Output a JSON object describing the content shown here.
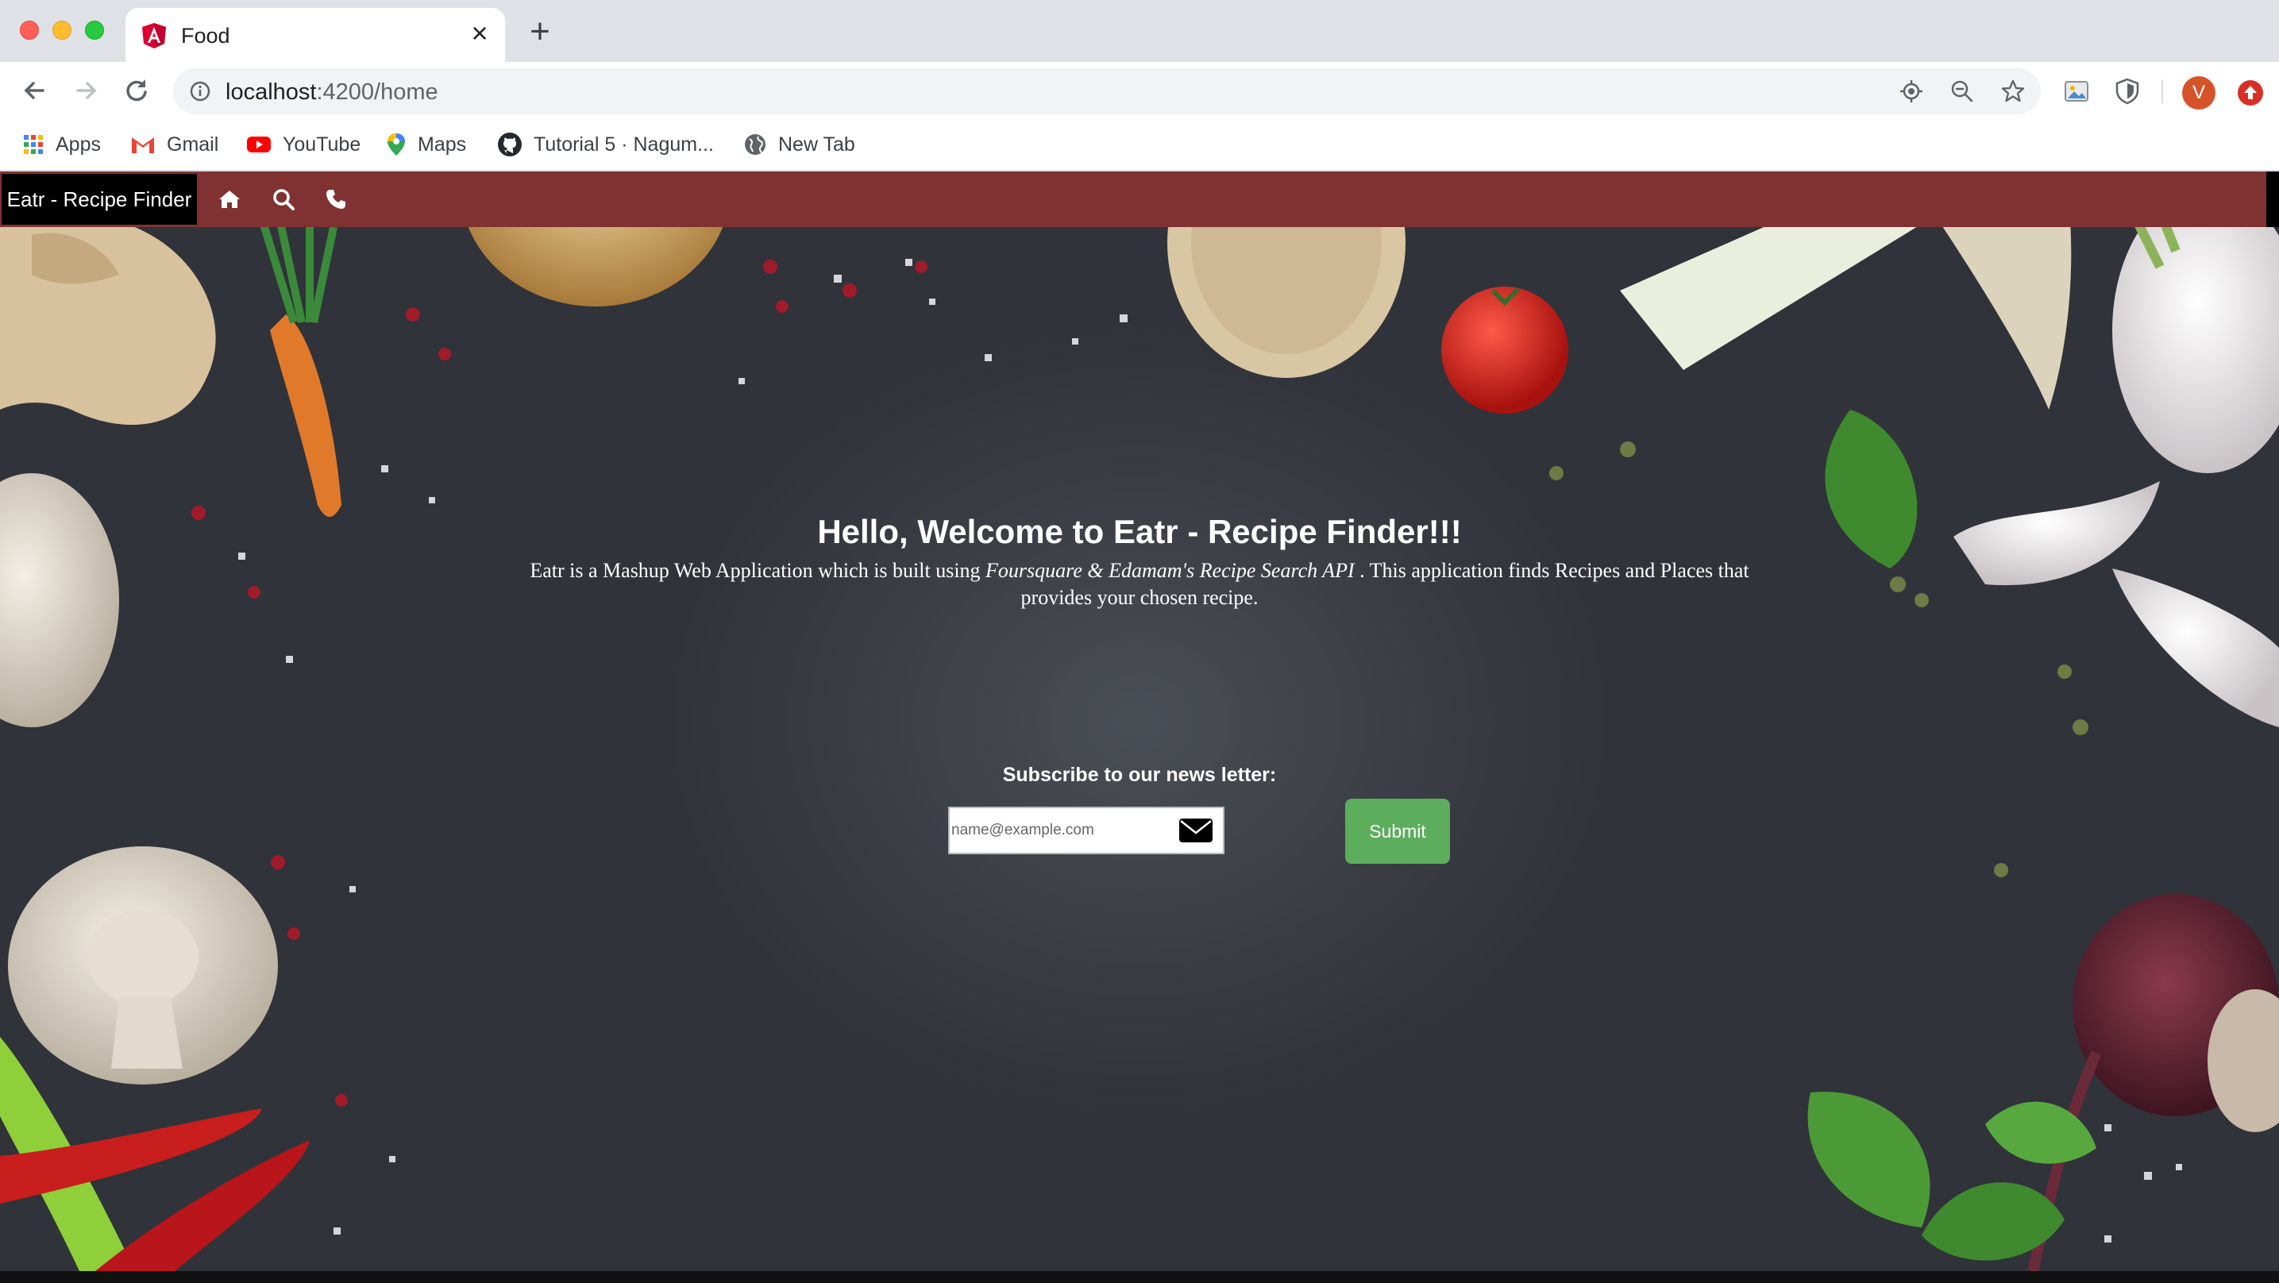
{
  "browser": {
    "tab_title": "Food",
    "tab_icon": "angular-icon",
    "url_host": "localhost",
    "url_path": ":4200/home",
    "avatar_letter": "V",
    "bookmarks": [
      {
        "label": "Apps",
        "icon": "apps-grid-icon"
      },
      {
        "label": "Gmail",
        "icon": "gmail-icon"
      },
      {
        "label": "YouTube",
        "icon": "youtube-icon"
      },
      {
        "label": "Maps",
        "icon": "maps-icon"
      },
      {
        "label": "Tutorial 5 · Nagum...",
        "icon": "github-icon"
      },
      {
        "label": "New Tab",
        "icon": "globe-icon"
      }
    ]
  },
  "navbar": {
    "brand": "Eatr - Recipe Finder",
    "icons": [
      "home-icon",
      "search-icon",
      "phone-icon"
    ],
    "color": "#803232"
  },
  "hero": {
    "welcome_prefix": "Hello, Welcome to ",
    "welcome_app": "Eatr - Recipe Finder!!!",
    "desc_before": "Eatr is a Mashup Web Application which is built using ",
    "desc_apis": "Foursquare & Edamam's Recipe Search API",
    "desc_after": " . This application finds Recipes and Places that provides your chosen recipe."
  },
  "newsletter": {
    "label": "Subscribe to our news letter:",
    "email_placeholder": "name@example.com",
    "email_value": "",
    "submit_label": "Submit",
    "submit_color": "#5cad5c"
  }
}
